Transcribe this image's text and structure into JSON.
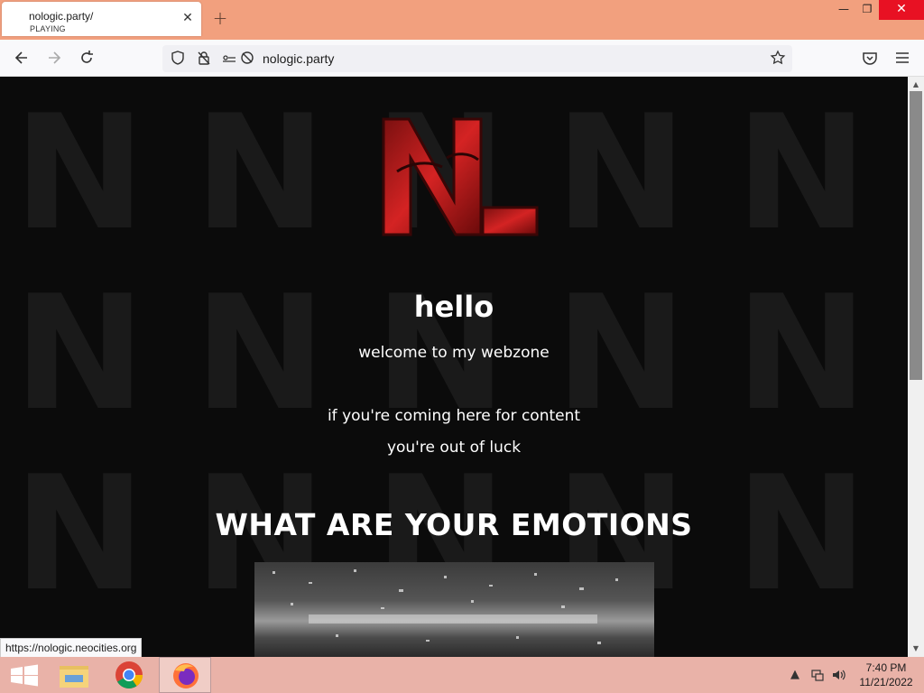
{
  "browser": {
    "tab": {
      "title": "nologic.party/",
      "status": "PLAYING"
    },
    "address": "nologic.party",
    "status_url": "https://nologic.neocities.org"
  },
  "page": {
    "heading": "hello",
    "welcome": "welcome to my webzone",
    "line1": "if you're coming here for content",
    "line2": "you're out of luck",
    "emotions": "WHAT ARE YOUR EMOTIONS",
    "bg_letter": "N",
    "background_color": "#0b0b0b",
    "text_color": "#ffffff"
  },
  "taskbar": {
    "time": "7:40 PM",
    "date": "11/21/2022"
  },
  "icons": {
    "back": "back-arrow-icon",
    "forward": "forward-arrow-icon",
    "reload": "reload-icon",
    "shield": "tracking-protection-icon",
    "lock": "lock-icon",
    "bookmark": "star-icon",
    "pocket": "pocket-icon",
    "menu": "hamburger-menu-icon"
  },
  "colors": {
    "titlebar": "#f2a07e",
    "taskbar": "#e9b2a8",
    "close": "#e81123"
  }
}
